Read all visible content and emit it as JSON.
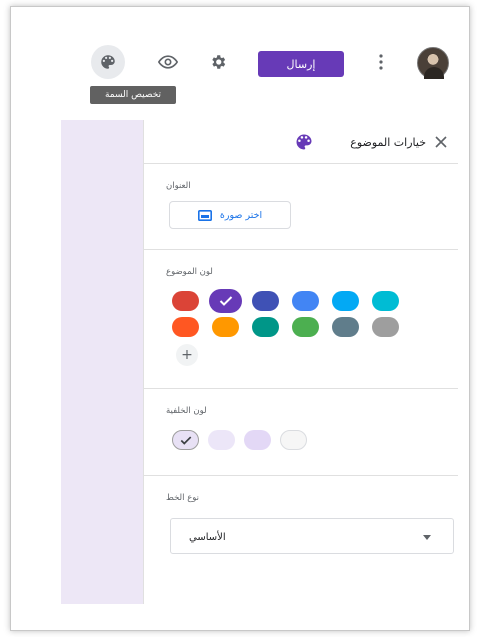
{
  "toolbar": {
    "icons": [
      "palette-icon",
      "eye-icon",
      "gear-icon",
      "more-vert-icon"
    ],
    "send_label": "إرسال",
    "tooltip": "تخصيص السمة"
  },
  "panel": {
    "title": "خيارات الموضوع",
    "header_section": {
      "label": "العنوان",
      "choose_image_label": "اختر صورة"
    },
    "theme_color": {
      "label": "لون الموضوع",
      "selected_color": "#673ab7",
      "row1": [
        "#db4437",
        "#673ab7",
        "#3f51b5",
        "#4285f4",
        "#03a9f4",
        "#00bcd4"
      ],
      "row2": [
        "#ff5722",
        "#ff9800",
        "#009688",
        "#4caf50",
        "#607d8b",
        "#9e9e9e"
      ],
      "add_label": "+"
    },
    "background_color": {
      "label": "لون الخلفية",
      "colors": [
        "#e8e1f5",
        "#ece6f8",
        "#e3d8f6",
        "#f6f6f6"
      ],
      "selected_index": 0
    },
    "font_style": {
      "label": "نوع الخط",
      "value": "الأساسي"
    }
  },
  "colors": {
    "accent": "#673ab7",
    "page_background": "#ede7f6"
  }
}
